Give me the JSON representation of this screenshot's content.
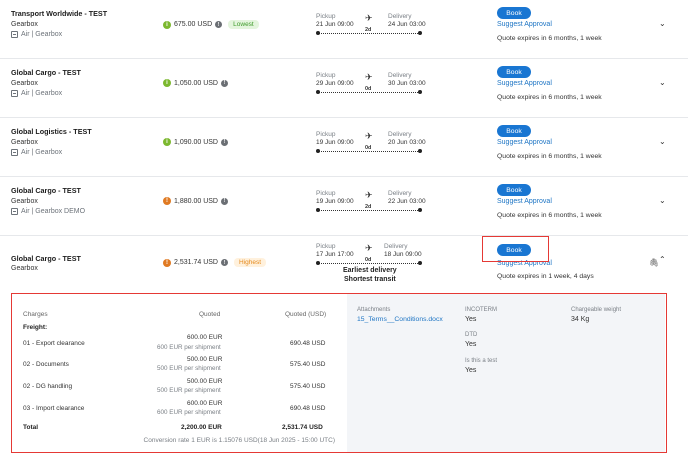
{
  "quotes": [
    {
      "name": "Transport Worldwide - TEST",
      "subtitle": "Gearbox",
      "mode": "Air | Gearbox",
      "price": "675.00 USD",
      "badge": "Lowest",
      "pickup_label": "Pickup",
      "pickup_date": "21 Jun 09:00",
      "delivery_label": "Delivery",
      "delivery_date": "24 Jun 03:00",
      "transit": "2d",
      "book_label": "Book",
      "suggest_label": "Suggest Approval",
      "expiry": "Quote expires in 6 months, 1 week"
    },
    {
      "name": "Global Cargo - TEST",
      "subtitle": "Gearbox",
      "mode": "Air | Gearbox",
      "price": "1,050.00 USD",
      "badge": "",
      "pickup_label": "Pickup",
      "pickup_date": "29 Jun 09:00",
      "delivery_label": "Delivery",
      "delivery_date": "30 Jun 03:00",
      "transit": "0d",
      "book_label": "Book",
      "suggest_label": "Suggest Approval",
      "expiry": "Quote expires in 6 months, 1 week"
    },
    {
      "name": "Global Logistics - TEST",
      "subtitle": "Gearbox",
      "mode": "Air | Gearbox",
      "price": "1,090.00 USD",
      "badge": "",
      "pickup_label": "Pickup",
      "pickup_date": "19 Jun 09:00",
      "delivery_label": "Delivery",
      "delivery_date": "20 Jun 03:00",
      "transit": "0d",
      "book_label": "Book",
      "suggest_label": "Suggest Approval",
      "expiry": "Quote expires in 6 months, 1 week"
    },
    {
      "name": "Global Cargo - TEST",
      "subtitle": "Gearbox",
      "mode": "Air | Gearbox DEMO",
      "price": "1,880.00 USD",
      "badge": "",
      "pickup_label": "Pickup",
      "pickup_date": "19 Jun 09:00",
      "delivery_label": "Delivery",
      "delivery_date": "22 Jun 03:00",
      "transit": "2d",
      "book_label": "Book",
      "suggest_label": "Suggest Approval",
      "expiry": "Quote expires in 6 months, 1 week"
    },
    {
      "name": "Global Cargo - TEST",
      "subtitle": "Gearbox",
      "mode": "",
      "price": "2,531.74 USD",
      "badge": "Highest",
      "pickup_label": "Pickup",
      "pickup_date": "17 Jun 17:00",
      "delivery_label": "Delivery",
      "delivery_date": "18 Jun 09:00",
      "transit": "0d",
      "book_label": "Book",
      "suggest_label": "Suggest Approval",
      "expiry": "Quote expires in 1 week, 4 days",
      "tags": [
        "Earliest delivery",
        "Shortest transit"
      ]
    }
  ],
  "details": {
    "headers": {
      "charges": "Charges",
      "quoted": "Quoted",
      "quoted_usd": "Quoted (USD)"
    },
    "group_label": "Freight:",
    "lines": [
      {
        "name": "01 - Export clearance",
        "quoted": "600.00 EUR",
        "per": "600 EUR per shipment",
        "usd": "690.48 USD"
      },
      {
        "name": "02 - Documents",
        "quoted": "500.00 EUR",
        "per": "500 EUR per shipment",
        "usd": "575.40 USD"
      },
      {
        "name": "02 - DG handling",
        "quoted": "500.00 EUR",
        "per": "500 EUR per shipment",
        "usd": "575.40 USD"
      },
      {
        "name": "03 - Import clearance",
        "quoted": "600.00 EUR",
        "per": "600 EUR per shipment",
        "usd": "690.48 USD"
      }
    ],
    "total": {
      "label": "Total",
      "quoted": "2,200.00 EUR",
      "usd": "2,531.74 USD"
    },
    "conversion": "Conversion rate 1 EUR is 1.15076 USD(18 Jun 2025 - 15:00 UTC)",
    "attachments_label": "Attachments",
    "attachment_file": "15_Terms__Conditions.docx",
    "incoterm_label": "INCOTERM",
    "incoterm_value": "Yes",
    "dtd_label": "DTD",
    "dtd_value": "Yes",
    "test_label": "Is this a test",
    "test_value": "Yes",
    "weight_label": "Chargeable weight",
    "weight_value": "34 Kg"
  },
  "colors": {
    "accent": "#1976d2",
    "highlight": "#e53935",
    "good": "#7cb82f",
    "warn": "#e07a22"
  }
}
